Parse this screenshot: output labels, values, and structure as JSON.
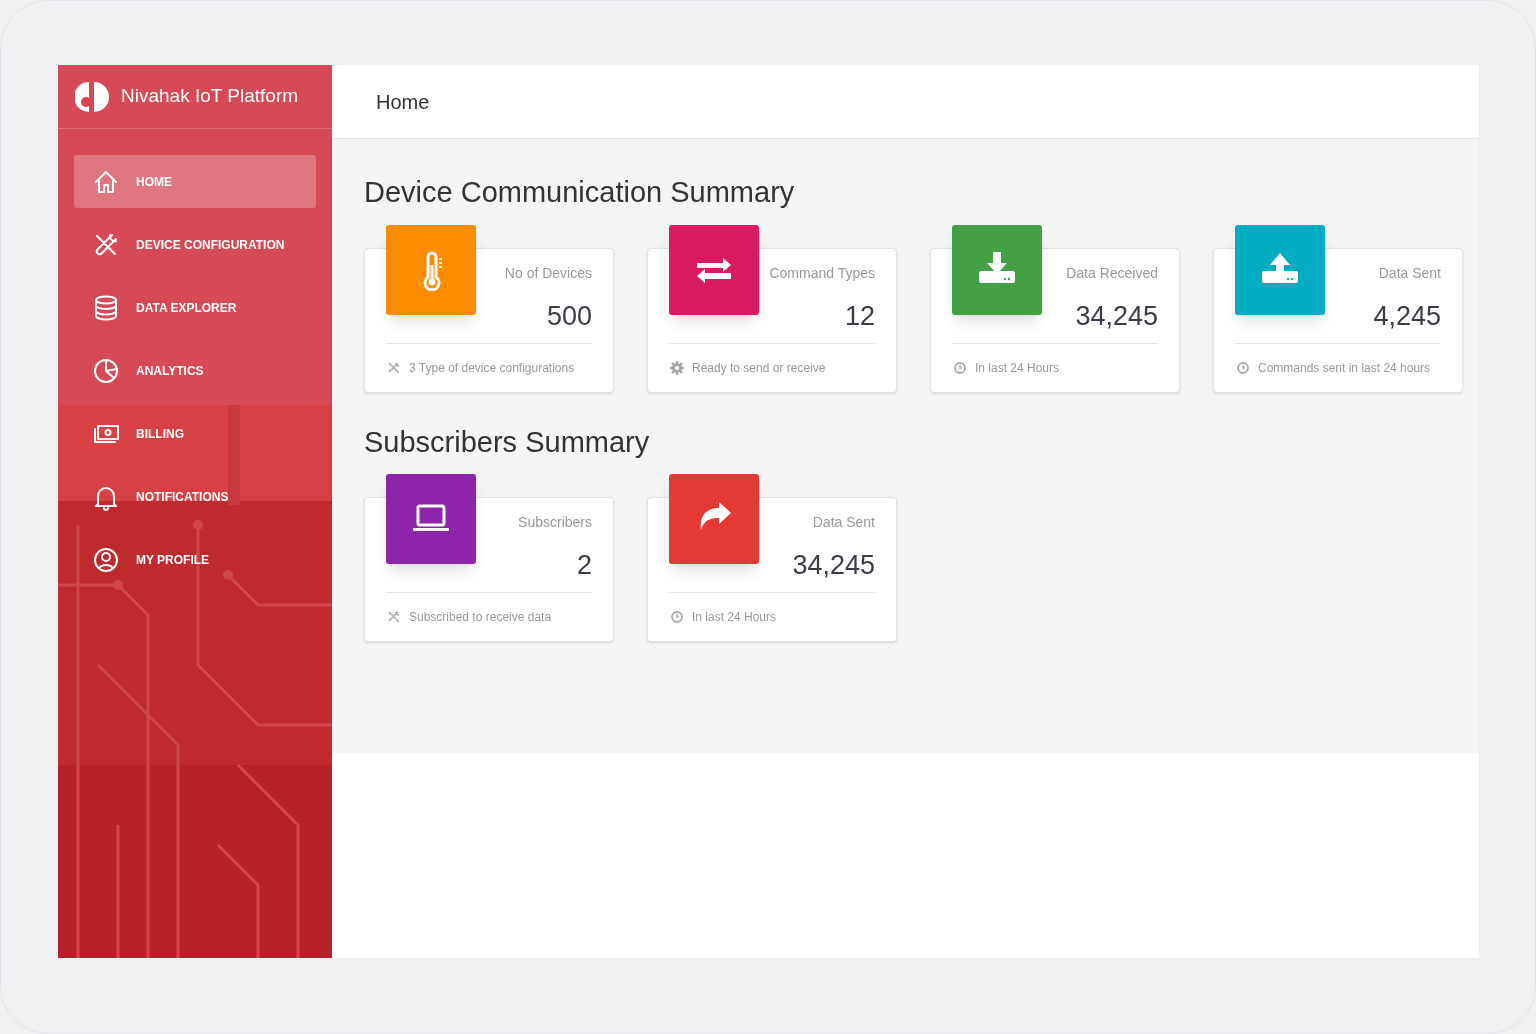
{
  "sidebar": {
    "brand": "Nivahak IoT Platform",
    "items": [
      {
        "label": "HOME",
        "selected": true
      },
      {
        "label": "DEVICE CONFIGURATION",
        "selected": false
      },
      {
        "label": "DATA EXPLORER",
        "selected": false
      },
      {
        "label": "ANALYTICS",
        "selected": false
      },
      {
        "label": "BILLING",
        "selected": false
      },
      {
        "label": "NOTIFICATIONS",
        "selected": false
      },
      {
        "label": "MY PROFILE",
        "selected": false
      }
    ]
  },
  "header": {
    "title": "Home"
  },
  "sections": [
    {
      "title": "Device Communication Summary",
      "cards": [
        {
          "label": "No of Devices",
          "value": "500",
          "footer": "3 Type of device configurations",
          "color": "#fb8c00"
        },
        {
          "label": "Command Types",
          "value": "12",
          "footer": "Ready to send or receive",
          "color": "#d81b60"
        },
        {
          "label": "Data Received",
          "value": "34,245",
          "footer": "In last 24 Hours",
          "color": "#43a047"
        },
        {
          "label": "Data Sent",
          "value": "4,245",
          "footer": "Commands sent in last 24 hours",
          "color": "#00acc1"
        }
      ]
    },
    {
      "title": "Subscribers Summary",
      "cards": [
        {
          "label": "Subscribers",
          "value": "2",
          "footer": "Subscribed to receive data",
          "color": "#8e24aa"
        },
        {
          "label": "Data Sent",
          "value": "34,245",
          "footer": "In last 24 Hours",
          "color": "#e53935"
        }
      ]
    }
  ]
}
